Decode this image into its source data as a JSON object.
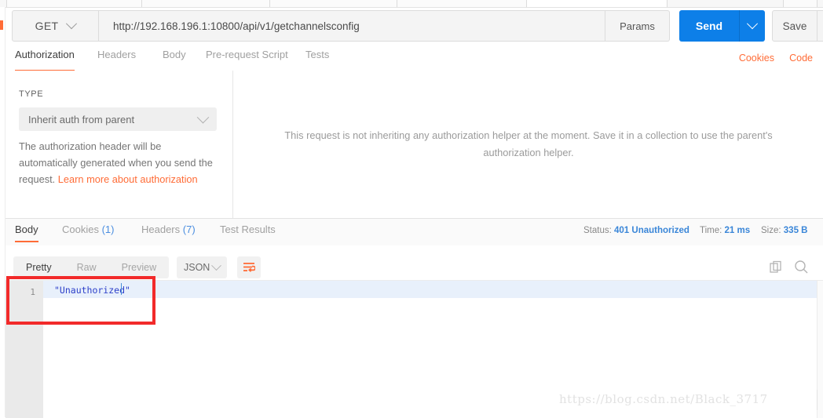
{
  "request": {
    "method": "GET",
    "url": "http://192.168.196.1:10800/api/v1/getchannelsconfig",
    "params_label": "Params",
    "send_label": "Send",
    "save_label": "Save",
    "tabs": [
      {
        "label": "Authorization",
        "active": true
      },
      {
        "label": "Headers",
        "active": false
      },
      {
        "label": "Body",
        "active": false
      },
      {
        "label": "Pre-request Script",
        "active": false
      },
      {
        "label": "Tests",
        "active": false
      }
    ],
    "links": [
      {
        "label": "Cookies"
      },
      {
        "label": "Code"
      }
    ]
  },
  "authorization": {
    "type_label": "TYPE",
    "type_value": "Inherit auth from parent",
    "note_text": "The authorization header will be automatically generated when you send the request. ",
    "note_link": "Learn more about authorization",
    "description": "This request is not inheriting any authorization helper at the moment. Save it in a collection to use the parent's authorization helper."
  },
  "response": {
    "tabs": [
      {
        "label": "Body",
        "count": "",
        "active": true
      },
      {
        "label": "Cookies",
        "count": "(1)",
        "active": false
      },
      {
        "label": "Headers",
        "count": "(7)",
        "active": false
      },
      {
        "label": "Test Results",
        "count": "",
        "active": false
      }
    ],
    "meta": {
      "status_label": "Status:",
      "status_value": "401 Unauthorized",
      "time_label": "Time:",
      "time_value": "21 ms",
      "size_label": "Size:",
      "size_value": "335 B"
    },
    "view_modes": [
      {
        "label": "Pretty",
        "active": true
      },
      {
        "label": "Raw",
        "active": false
      },
      {
        "label": "Preview",
        "active": false
      }
    ],
    "format": "JSON",
    "body": {
      "line_number": "1",
      "content": "\"Unauthorized\""
    }
  },
  "icons": {
    "chevron_down": "chevron-down-icon",
    "wrap_lines": "wrap-lines-icon",
    "copy": "copy-icon",
    "search": "search-icon"
  },
  "colors": {
    "accent_orange": "#ff6c37",
    "send_blue": "#0d7fe8",
    "meta_blue": "#3a86d8",
    "annotation_red": "#f22a2a"
  },
  "watermark": "https://blog.csdn.net/Black_3717"
}
